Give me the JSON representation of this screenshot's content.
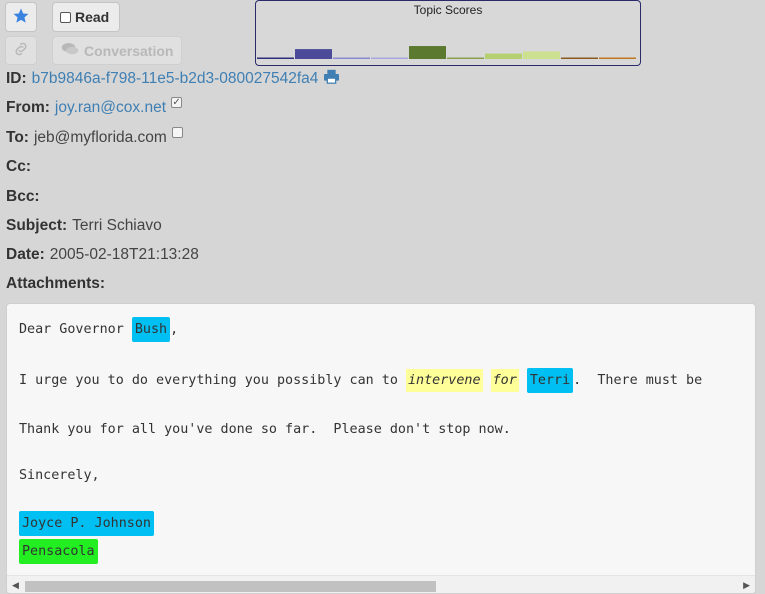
{
  "toolbar": {
    "read_label": "Read",
    "conversation_label": "Conversation"
  },
  "topic_scores": {
    "title": "Topic Scores",
    "bars": [
      {
        "value": 0.08,
        "color": "#2e2e7a"
      },
      {
        "value": 0.55,
        "color": "#4b4b9a"
      },
      {
        "value": 0.04,
        "color": "#8a8ad0"
      },
      {
        "value": 0.03,
        "color": "#a8a8e0"
      },
      {
        "value": 0.72,
        "color": "#5b7a30"
      },
      {
        "value": 0.03,
        "color": "#8aa050"
      },
      {
        "value": 0.3,
        "color": "#b4d070"
      },
      {
        "value": 0.42,
        "color": "#cde090"
      },
      {
        "value": 0.05,
        "color": "#8a5a20"
      },
      {
        "value": 0.06,
        "color": "#c07820"
      }
    ]
  },
  "email": {
    "id_label": "ID:",
    "id_value": "b7b9846a-f798-11e5-b2d3-080027542fa4",
    "from_label": "From:",
    "from_value": "joy.ran@cox.net",
    "to_label": "To:",
    "to_value": "jeb@myflorida.com",
    "cc_label": "Cc:",
    "bcc_label": "Bcc:",
    "subject_label": "Subject:",
    "subject_value": "Terri Schiavo",
    "date_label": "Date:",
    "date_value": "2005-02-18T21:13:28",
    "attachments_label": "Attachments:"
  },
  "body": {
    "greeting_prefix": "Dear Governor ",
    "greeting_entity": "Bush",
    "greeting_suffix": ",",
    "p1_prefix": "I urge you to do everything you possibly can to ",
    "p1_kw1": "intervene",
    "p1_kw2": "for",
    "p1_entity": "Terri",
    "p1_suffix": ".  There must be",
    "p2": "Thank you for all you've done so far.  Please don't stop now.",
    "closing": "Sincerely,",
    "signature_name": "Joyce P. Johnson",
    "signature_place": "Pensacola"
  },
  "colors": {
    "entity_person": "#00bff2",
    "keyword": "#ffff9a",
    "entity_location": "#22ee22",
    "link": "#3f7fb3"
  }
}
